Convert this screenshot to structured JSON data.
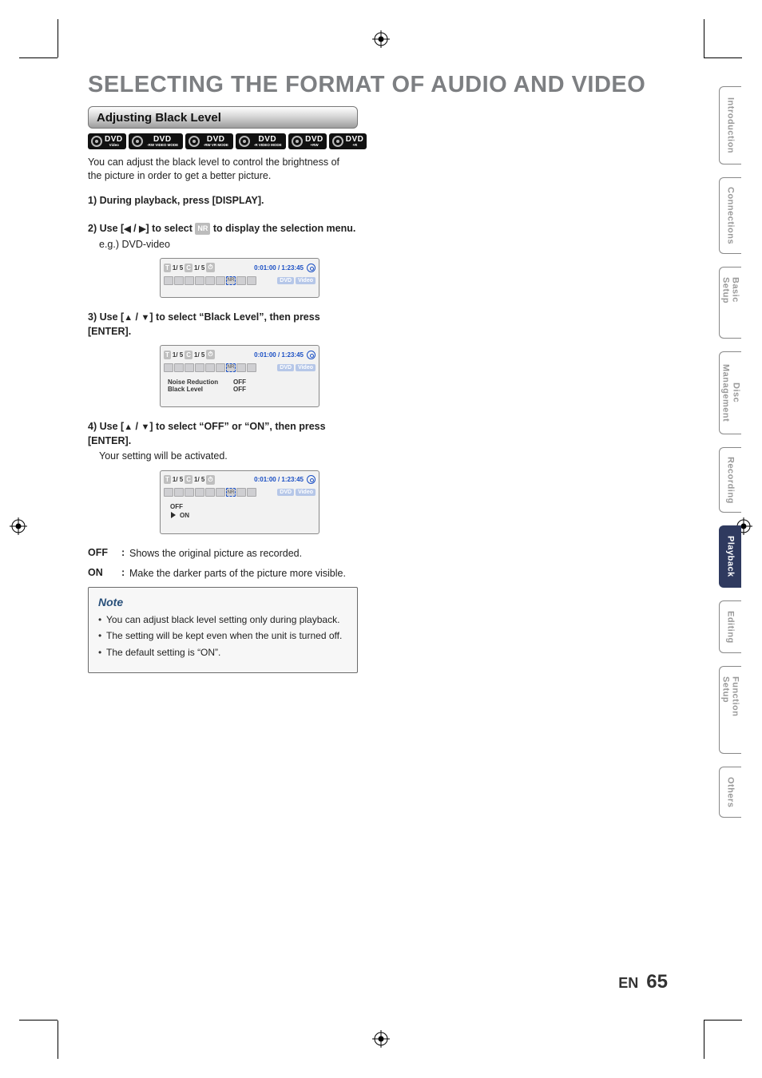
{
  "page": {
    "title": "SELECTING THE FORMAT OF AUDIO AND VIDEO",
    "footer_lang": "EN",
    "footer_page": "65"
  },
  "section": {
    "bar_title": "Adjusting Black Level"
  },
  "discs": [
    {
      "main": "DVD",
      "sub": "Video"
    },
    {
      "main": "DVD",
      "sub": "-RW VIDEO MODE"
    },
    {
      "main": "DVD",
      "sub": "-RW VR MODE"
    },
    {
      "main": "DVD",
      "sub": "-R VIDEO MODE"
    },
    {
      "main": "DVD",
      "sub": "+RW"
    },
    {
      "main": "DVD",
      "sub": "+R"
    }
  ],
  "intro": "You can adjust the black level to control the brightness of the picture in order to get a better picture.",
  "steps": {
    "s1": {
      "num": "1)",
      "body": "During playback, press [DISPLAY]."
    },
    "s2": {
      "num": "2)",
      "pre": "Use [",
      "mid1": " / ",
      "mid2": "] to select ",
      "nr": "NR",
      "post": " to display the selection menu.",
      "sub": "e.g.) DVD-video"
    },
    "s3": {
      "num": "3)",
      "pre": "Use [",
      "mid1": " / ",
      "post": "] to select “Black Level”, then press [ENTER]."
    },
    "s4": {
      "num": "4)",
      "pre": "Use [",
      "mid1": " / ",
      "post": "] to select “OFF” or “ON”, then press [ENTER].",
      "sub": "Your setting will be activated."
    }
  },
  "osd": {
    "row1": {
      "t_label": "T",
      "t_val": "1/  5",
      "c_label": "C",
      "c_val": "1/  5",
      "clock": "⏱",
      "time": "0:01:00 / 1:23:45"
    },
    "row2": {
      "dvd": "DVD",
      "video": "Video"
    },
    "menu": [
      {
        "label": "Noise Reduction",
        "value": "OFF"
      },
      {
        "label": "Black Level",
        "value": "OFF"
      }
    ],
    "toggle": {
      "opt1": "OFF",
      "opt2": "ON"
    },
    "mini_labels": [
      "",
      "",
      "",
      "",
      "",
      "",
      "NR",
      "",
      ""
    ]
  },
  "defs": {
    "off": {
      "k": "OFF",
      "v": "Shows the original picture as recorded."
    },
    "on": {
      "k": "ON",
      "v": "Make the darker parts of the picture more visible."
    }
  },
  "note": {
    "title": "Note",
    "items": [
      "You can adjust black level setting only during playback.",
      "The setting will be kept even when the unit is turned off.",
      "The default setting is “ON”."
    ]
  },
  "tabs": [
    {
      "label": "Introduction",
      "active": false,
      "h": "h1"
    },
    {
      "label": "Connections",
      "active": false,
      "h": "h2"
    },
    {
      "label": "Basic Setup",
      "active": false,
      "h": "h3"
    },
    {
      "label": "Disc\nManagement",
      "active": false,
      "h": "h4",
      "double": true
    },
    {
      "label": "Recording",
      "active": false,
      "h": "h5"
    },
    {
      "label": "Playback",
      "active": true,
      "h": "h6"
    },
    {
      "label": "Editing",
      "active": false,
      "h": "h7"
    },
    {
      "label": "Function Setup",
      "active": false,
      "h": "h8"
    },
    {
      "label": "Others",
      "active": false,
      "h": "h9"
    }
  ]
}
